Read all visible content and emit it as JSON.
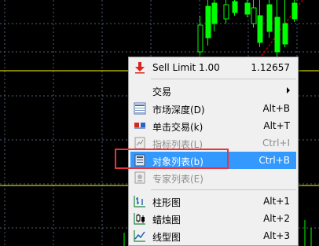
{
  "chart": {
    "background": "#000000",
    "grid_color": "#4f5d73",
    "bull_candle_color": "#00ff00",
    "bear_candle_color": "#000000",
    "level_line_color": "#ffff00",
    "trend_line_color": "#ff0000"
  },
  "context_menu": {
    "header": {
      "label": "Sell Limit 1.00",
      "price": "1.12657",
      "icon": "sell-limit-red-arrow-icon"
    },
    "trade": {
      "label": "交易",
      "has_submenu": true
    },
    "items": [
      {
        "label": "市场深度(D)",
        "shortcut": "Alt+B",
        "icon": "market-depth-icon",
        "enabled": true
      },
      {
        "label": "单击交易(k)",
        "shortcut": "Alt+T",
        "icon": "one-click-trading-icon",
        "enabled": true
      },
      {
        "label": "指标列表(L)",
        "shortcut": "Ctrl+I",
        "icon": "indicators-list-icon",
        "enabled": false
      },
      {
        "label": "对象列表(b)",
        "shortcut": "Ctrl+B",
        "icon": "objects-list-icon",
        "enabled": true,
        "selected": true
      },
      {
        "label": "专家列表(E)",
        "shortcut": "",
        "icon": "experts-list-icon",
        "enabled": false
      }
    ],
    "chart_types": [
      {
        "label": "柱形图",
        "shortcut": "Alt+1",
        "icon": "bar-chart-icon"
      },
      {
        "label": "蜡烛图",
        "shortcut": "Alt+2",
        "icon": "candlestick-chart-icon"
      },
      {
        "label": "线型图",
        "shortcut": "Alt+3",
        "icon": "line-chart-icon"
      }
    ],
    "selected_color": "#3399ff",
    "highlight_box_color": "#e8343a"
  }
}
